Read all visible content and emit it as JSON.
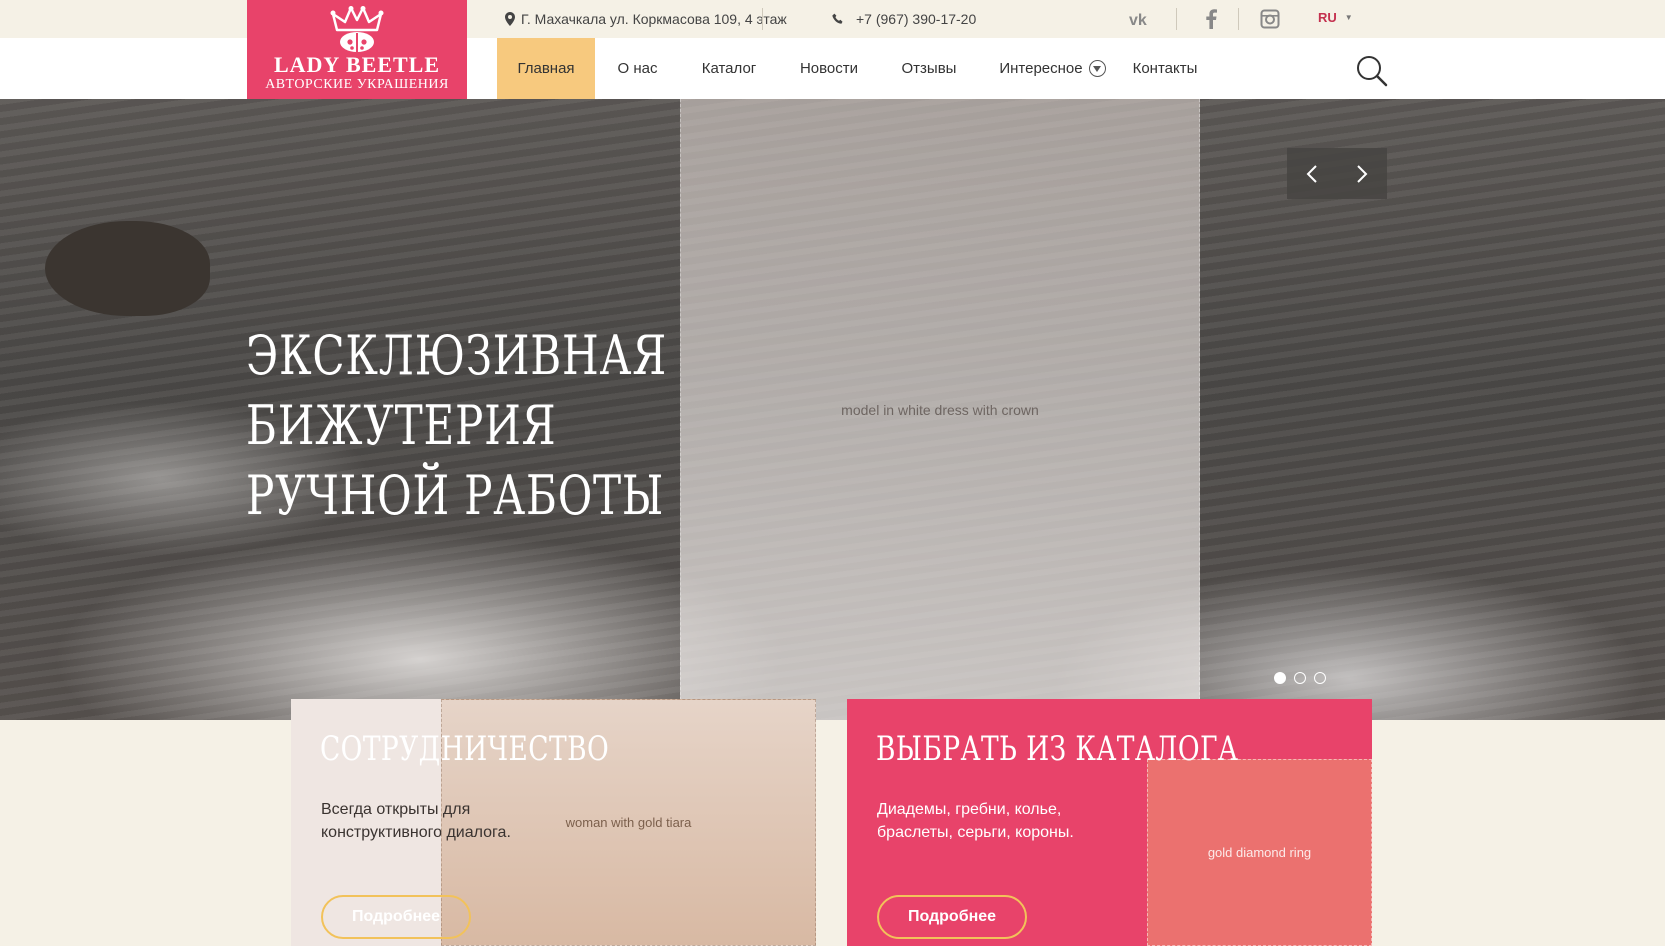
{
  "logo": {
    "brand": "LADY BEETLE",
    "tagline": "АВТОРСКИЕ УКРАШЕНИЯ",
    "icon": "crown-ladybug-icon",
    "bg_color": "#e8436a"
  },
  "topbar": {
    "address": "Г. Махачкала ул. Коркмасова 109, 4 этаж",
    "phone": "+7 (967) 390-17-20",
    "social": [
      "vk-icon",
      "facebook-icon",
      "instagram-icon"
    ],
    "language": "RU"
  },
  "nav": {
    "items": [
      {
        "label": "Главная",
        "active": true
      },
      {
        "label": "О нас"
      },
      {
        "label": "Каталог"
      },
      {
        "label": "Новости"
      },
      {
        "label": "Отзывы"
      },
      {
        "label": "Интересное",
        "has_dropdown": true
      },
      {
        "label": "Контакты"
      }
    ],
    "search_icon": "search-icon",
    "active_color": "#f7c97e"
  },
  "hero": {
    "title_line1": "Эксклюзивная бижутерия",
    "title_line2": "ручной работы",
    "slide_count": 3,
    "active_slide": 1
  },
  "cards": [
    {
      "title": "Сотрудничество",
      "text": "Всегда открыты для конструктивного диалога.",
      "button": "Подробнее"
    },
    {
      "title": "Выбрать из каталога",
      "text": "Диадемы, гребни, колье, браслеты, серьги, короны.",
      "button": "Подробнее"
    }
  ],
  "colors": {
    "accent_pink": "#e8436a",
    "accent_gold": "#f2c25a",
    "background": "#f5f1e6"
  }
}
